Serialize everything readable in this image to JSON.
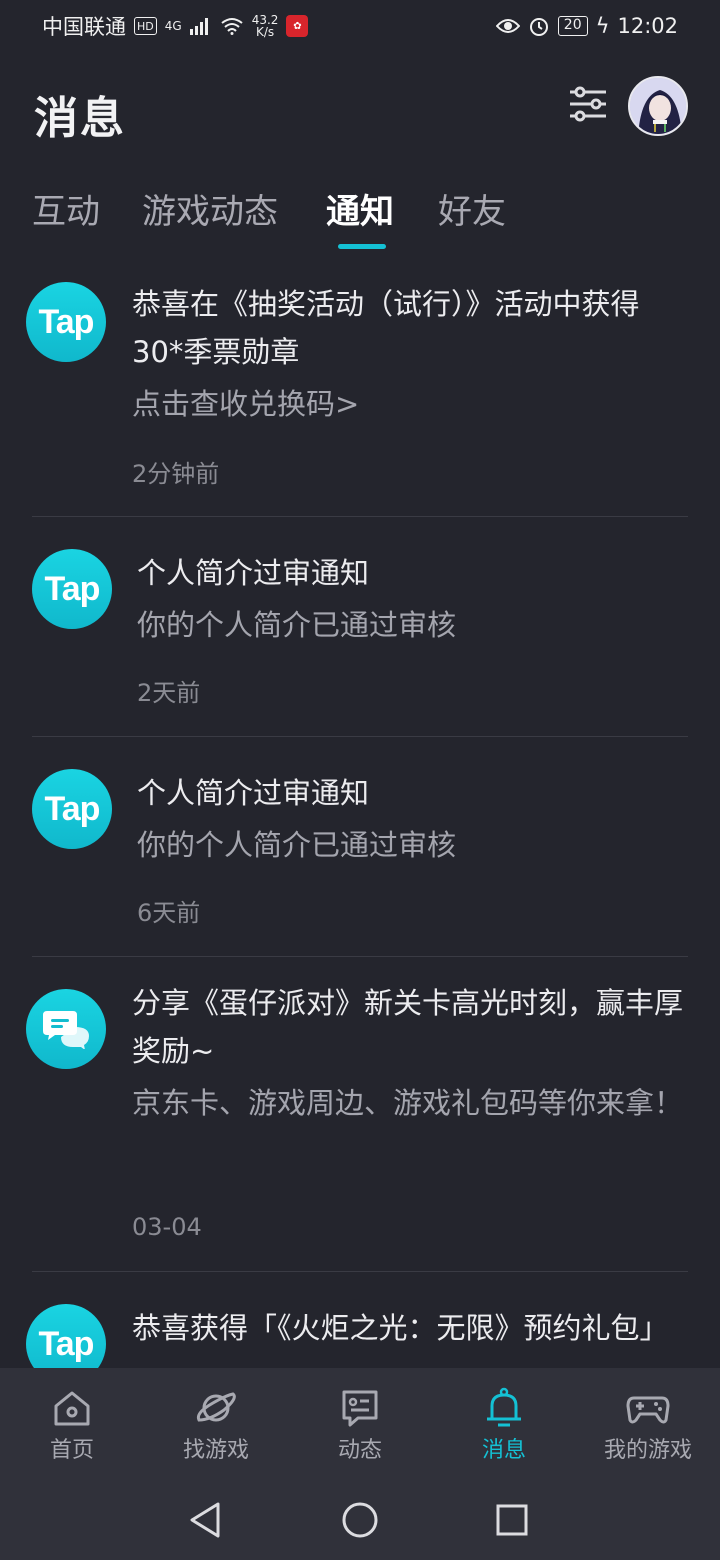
{
  "status_bar": {
    "carrier": "中国联通",
    "hd": "HD",
    "network": "4G",
    "speed_value": "43.2",
    "speed_unit": "K/s",
    "battery": "20",
    "time": "12:02"
  },
  "header": {
    "title": "消息"
  },
  "tabs": [
    {
      "label": "互动",
      "active": false
    },
    {
      "label": "游戏动态",
      "active": false
    },
    {
      "label": "通知",
      "active": true
    },
    {
      "label": "好友",
      "active": false
    }
  ],
  "notifications": [
    {
      "icon": "tap-logo",
      "logo_text": "Tap",
      "title": "恭喜在《抽奖活动（试行）》活动中获得30*季票勋章",
      "desc": "点击查收兑换码>",
      "time": "2分钟前"
    },
    {
      "icon": "tap-logo",
      "logo_text": "Tap",
      "title": "个人简介过审通知",
      "desc": "你的个人简介已通过审核",
      "time": "2天前"
    },
    {
      "icon": "tap-logo",
      "logo_text": "Tap",
      "title": "个人简介过审通知",
      "desc": "你的个人简介已通过审核",
      "time": "6天前"
    },
    {
      "icon": "chat-bubble-icon",
      "title": "分享《蛋仔派对》新关卡高光时刻，赢丰厚奖励~",
      "desc": "京东卡、游戏周边、游戏礼包码等你来拿！",
      "time": "03-04"
    },
    {
      "icon": "tap-logo",
      "logo_text": "Tap",
      "title": "恭喜获得「《火炬之光：无限》预约礼包」"
    }
  ],
  "bottom_nav": [
    {
      "label": "首页",
      "icon": "home-icon",
      "active": false
    },
    {
      "label": "找游戏",
      "icon": "planet-icon",
      "active": false
    },
    {
      "label": "动态",
      "icon": "feed-icon",
      "active": false
    },
    {
      "label": "消息",
      "icon": "bell-icon",
      "active": true
    },
    {
      "label": "我的游戏",
      "icon": "gamepad-icon",
      "active": false
    }
  ],
  "colors": {
    "accent": "#14c1d4",
    "background": "#24252d",
    "nav_background": "#30313a"
  }
}
